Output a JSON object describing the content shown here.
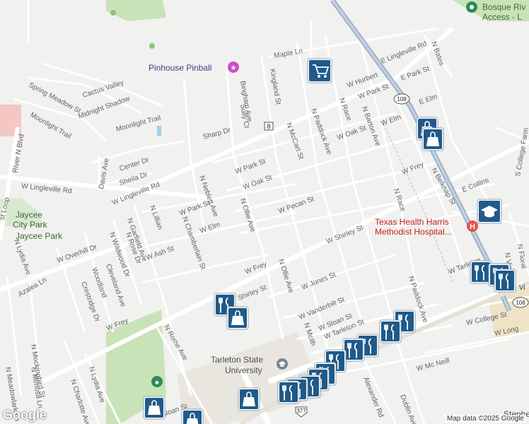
{
  "map": {
    "streets": [
      {
        "id": "w-lingleville-rd-w",
        "label": "W Lingleville Rd"
      },
      {
        "id": "w-lingleville-rd-n",
        "label": "W Lingleville Rd"
      },
      {
        "id": "e-lingleville-rd",
        "label": "E Lingleville Rd"
      },
      {
        "id": "maple-ln",
        "label": "Maple Ln"
      },
      {
        "id": "kingland-st",
        "label": "Kingland St"
      },
      {
        "id": "bingham-ave",
        "label": "Bingham Ave"
      },
      {
        "id": "sully-ct",
        "label": "Sully Ct"
      },
      {
        "id": "sharp-dr",
        "label": "Sharp Dr"
      },
      {
        "id": "moonlight-trail",
        "label": "Moonlight Trail"
      },
      {
        "id": "moonlight-trail-2",
        "label": "Moonlight Trail"
      },
      {
        "id": "midnight-shadow",
        "label": "Midnight Shadow"
      },
      {
        "id": "cactus-valley",
        "label": "Cactus Valley"
      },
      {
        "id": "spring-meadow-st",
        "label": "Spring Meadow St"
      },
      {
        "id": "river-n-blvd",
        "label": "River N Blvd"
      },
      {
        "id": "davis-ave",
        "label": "Davis Ave"
      },
      {
        "id": "center-dr",
        "label": "Center Dr"
      },
      {
        "id": "sheila-dr",
        "label": "Sheila Dr"
      },
      {
        "id": "loop",
        "label": "st Loop"
      },
      {
        "id": "n-neblett-ave",
        "label": "N Neblett Ave"
      },
      {
        "id": "w-park-st",
        "label": "W Park St"
      },
      {
        "id": "w-park-st-2",
        "label": "W Park St"
      },
      {
        "id": "w-oak-st",
        "label": "W Oak St"
      },
      {
        "id": "w-elm",
        "label": "W Elm"
      },
      {
        "id": "n-lillian",
        "label": "N Lillian"
      },
      {
        "id": "n-garfield-ave",
        "label": "N Garfield Ave"
      },
      {
        "id": "n-chamberlain-st",
        "label": "N Chamberlain St"
      },
      {
        "id": "w-ash-st",
        "label": "W Ash St"
      },
      {
        "id": "n-rose-dr",
        "label": "N Rose Dr"
      },
      {
        "id": "n-wildwood-dr",
        "label": "N Wildwood Dr"
      },
      {
        "id": "w-overhill-dr",
        "label": "W Overhill Dr"
      },
      {
        "id": "n-lydia-ave",
        "label": "N Lydia Ave"
      },
      {
        "id": "azalea-ln",
        "label": "Azalea Ln"
      },
      {
        "id": "woodland",
        "label": "Woodland"
      },
      {
        "id": "crestridge-dr",
        "label": "Crestridge Dr"
      },
      {
        "id": "cleveland-ave",
        "label": "Cleveland Ave"
      },
      {
        "id": "n-ollie-ave",
        "label": "N Ollie Ave"
      },
      {
        "id": "n-ollie-ave-2",
        "label": "N Ollie Ave"
      },
      {
        "id": "w-pecan-st",
        "label": "W Pecan St"
      },
      {
        "id": "n-mccart-st",
        "label": "N McCart St"
      },
      {
        "id": "n-paddock-ave",
        "label": "N Paddock Ave"
      },
      {
        "id": "n-paddock-ave-2",
        "label": "N Paddock Ave"
      },
      {
        "id": "n-race",
        "label": "N Race"
      },
      {
        "id": "n-race-2",
        "label": "N Race"
      },
      {
        "id": "n-barton-ave",
        "label": "N Barton Ave"
      },
      {
        "id": "w-hurbert",
        "label": "W Hurbert"
      },
      {
        "id": "w-oak-st-2",
        "label": "W Oak St"
      },
      {
        "id": "w-elm-2",
        "label": "W Elm"
      },
      {
        "id": "w-park-st-3",
        "label": "W Park St"
      },
      {
        "id": "e-park-st",
        "label": "E Park St"
      },
      {
        "id": "e-elm",
        "label": "E Elm"
      },
      {
        "id": "n-bates",
        "label": "N Bates"
      },
      {
        "id": "w-frey",
        "label": "W Frey"
      },
      {
        "id": "w-frey-2",
        "label": "W Frey"
      },
      {
        "id": "w-frey-3",
        "label": "W Frey"
      },
      {
        "id": "n-belknap-st",
        "label": "N Belknap St"
      },
      {
        "id": "e-collins",
        "label": "E Collins"
      },
      {
        "id": "s-college-farm",
        "label": "S College Farm"
      },
      {
        "id": "w-shirley-st",
        "label": "W Shirley St"
      },
      {
        "id": "shirley-st",
        "label": "Shirley St"
      },
      {
        "id": "w-jones-st",
        "label": "W Jones St"
      },
      {
        "id": "w-vanderbilt-st",
        "label": "W Vanderbilt St"
      },
      {
        "id": "w-sloan-st",
        "label": "W Sloan St"
      },
      {
        "id": "w-tarleton-st",
        "label": "W Tarleton St"
      },
      {
        "id": "n-mcilh",
        "label": "N McIlh"
      },
      {
        "id": "w-tarleton",
        "label": "W Tarleton"
      },
      {
        "id": "w-college-st",
        "label": "W College St"
      },
      {
        "id": "w-long",
        "label": "W Long"
      },
      {
        "id": "w-mc-neill",
        "label": "W Mc Neill"
      },
      {
        "id": "n-floral",
        "label": "N Floral"
      },
      {
        "id": "n-vine",
        "label": "N Vine"
      },
      {
        "id": "n-rome-ave",
        "label": "N Rome Ave"
      },
      {
        "id": "n-mockingbird-st",
        "label": "N Mockingbird St"
      },
      {
        "id": "n-mimosa-ln",
        "label": "N Mimosa Ln"
      },
      {
        "id": "n-meadowlark-ln",
        "label": "N Meadowlark Ln"
      },
      {
        "id": "n-charlotte-ave",
        "label": "N Charlotte Ave"
      },
      {
        "id": "n-lydia-ave-2",
        "label": "N Lydia Ave"
      },
      {
        "id": "alexander-rd",
        "label": "Alexander Rd"
      },
      {
        "id": "dublin-ave",
        "label": "Dublin Ave"
      },
      {
        "id": "sloan-st",
        "label": "Sloan St"
      }
    ],
    "shields": [
      "8",
      "108",
      "108",
      "377"
    ],
    "places": {
      "pinhouse": "Pinhouse Pinball",
      "jaycee1": "Jaycee",
      "jaycee2": "City Park",
      "jaycee3": "Jaycee Park",
      "hospital1": "Texas Health Harris",
      "hospital2": "Methodist Hospital...",
      "tarleton1": "Tarleton State",
      "tarleton2": "University",
      "bosque1": "Bosque Riv",
      "bosque2": "Access - L",
      "stephe": "Stephe",
      "vi": "vi"
    },
    "marker_icons": [
      "shopping-cart-icon",
      "shopping-bag-icon",
      "restaurant-icon",
      "graduation-cap-icon"
    ],
    "colors": {
      "marker": "#1f5a8a",
      "road": "#ffffff",
      "highway": "#9fb2c9",
      "park": "#c8e3b8",
      "land": "#f1f1ef"
    }
  },
  "attribution": "Map data ©2025 Google",
  "logo": "Google"
}
